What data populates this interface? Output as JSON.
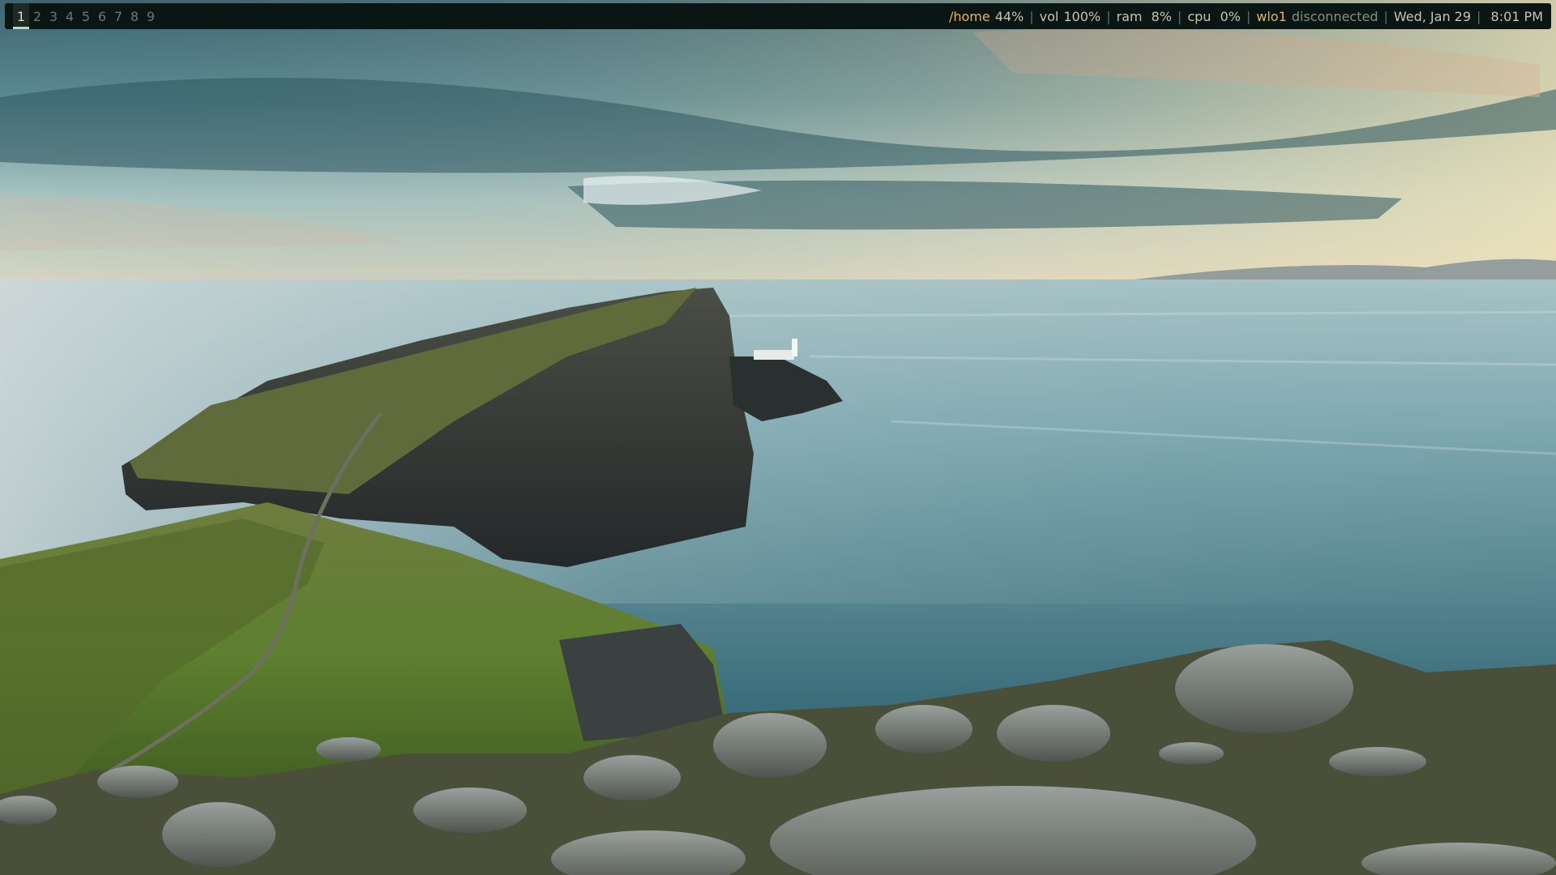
{
  "workspaces": [
    {
      "label": "1",
      "active": true
    },
    {
      "label": "2",
      "active": false
    },
    {
      "label": "3",
      "active": false
    },
    {
      "label": "4",
      "active": false
    },
    {
      "label": "5",
      "active": false
    },
    {
      "label": "6",
      "active": false
    },
    {
      "label": "7",
      "active": false
    },
    {
      "label": "8",
      "active": false
    },
    {
      "label": "9",
      "active": false
    }
  ],
  "status": {
    "disk_label": "/home",
    "disk_value": "44%",
    "vol_label": "vol",
    "vol_value": "100%",
    "ram_label": "ram",
    "ram_value": " 8%",
    "cpu_label": "cpu",
    "cpu_value": " 0%",
    "net_iface": "wlo1",
    "net_state": "disconnected",
    "date": "Wed, Jan 29",
    "time": " 8:01 PM",
    "separator": "|"
  },
  "colors": {
    "bar_bg": "#0a1614",
    "accent_yellow": "#e3b45f",
    "text": "#c8c5b0",
    "active_underline": "#b9d9b0"
  },
  "wallpaper": {
    "description_icon": "landscape-wallpaper-image"
  }
}
